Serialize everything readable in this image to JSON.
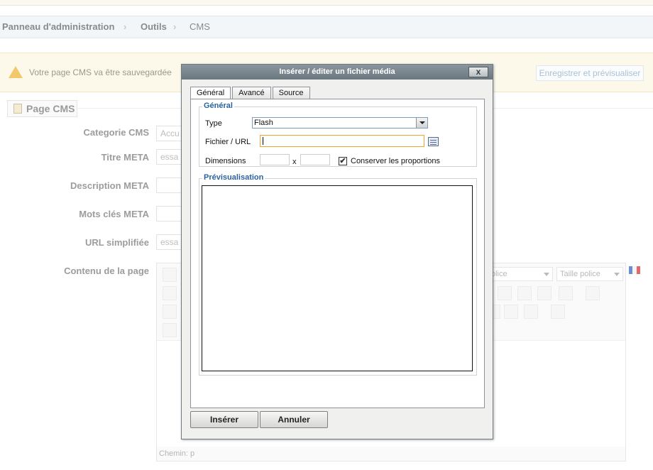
{
  "breadcrumb": {
    "items": [
      "Panneau d'administration",
      "Outils",
      "CMS"
    ]
  },
  "warning": {
    "text": "Votre page CMS va être sauvegardée"
  },
  "actions": {
    "save_preview_label": "Enregistrer et prévisualiser"
  },
  "form": {
    "legend": "Page CMS",
    "category_label": "Categorie CMS",
    "category_value": "Accu",
    "meta_title_label": "Titre META",
    "meta_title_value": "essa",
    "meta_desc_label": "Description META",
    "meta_keywords_label": "Mots clés META",
    "url_label": "URL simplifiée",
    "url_value": "essa",
    "content_label": "Contenu de la page"
  },
  "editor": {
    "font_select": "olice",
    "size_select": "Taille police",
    "path": "Chemin: p"
  },
  "dialog": {
    "title": "Insérer / éditer un fichier média",
    "close_label": "x",
    "tabs": [
      "Général",
      "Avancé",
      "Source"
    ],
    "general_legend": "Général",
    "type_label": "Type",
    "type_value": "Flash",
    "file_label": "Fichier / URL",
    "file_value": "",
    "dimensions_label": "Dimensions",
    "dim_separator": "x",
    "keep_proportions_label": "Conserver les proportions",
    "keep_proportions_checked": "✔",
    "preview_legend": "Prévisualisation",
    "insert_label": "Insérer",
    "cancel_label": "Annuler"
  },
  "colors": {
    "dialog_title": "#6b777f",
    "legend_blue": "#2b63a0",
    "focus_orange": "#f0a32e"
  }
}
